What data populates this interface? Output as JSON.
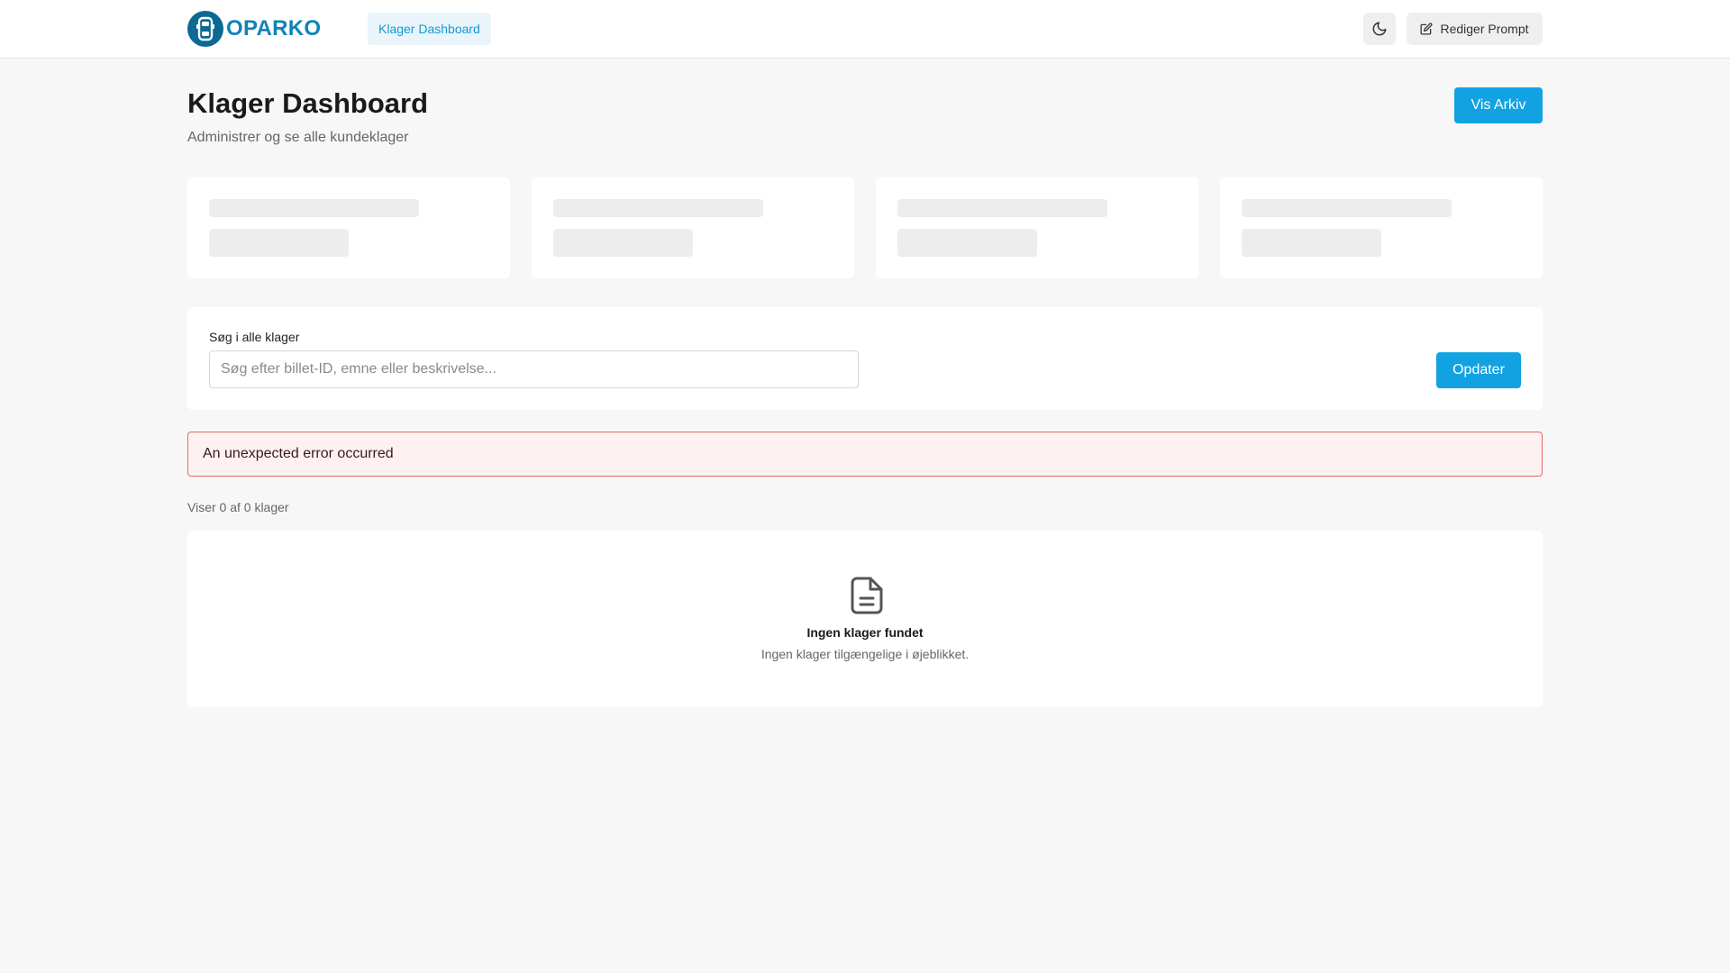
{
  "header": {
    "logo_text": "OPARKO",
    "nav_link": "Klager Dashboard",
    "edit_prompt_label": "Rediger Prompt"
  },
  "page": {
    "title": "Klager Dashboard",
    "subtitle": "Administrer og se alle kundeklager",
    "archive_button": "Vis Arkiv"
  },
  "search": {
    "label": "Søg i alle klager",
    "placeholder": "Søg efter billet-ID, emne eller beskrivelse...",
    "value": "",
    "refresh_button": "Opdater"
  },
  "error": {
    "message": "An unexpected error occurred"
  },
  "results": {
    "count_text": "Viser 0 af 0 klager",
    "empty_title": "Ingen klager fundet",
    "empty_subtitle": "Ingen klager tilgængelige i øjeblikket."
  },
  "icons": {
    "logo": "car-icon",
    "theme": "moon-icon",
    "edit": "edit-icon",
    "empty": "document-icon"
  },
  "colors": {
    "accent": "#12a2e2",
    "brand": "#0e84b8",
    "error_bg": "#fdf1f1",
    "error_border": "#e26b6b"
  }
}
